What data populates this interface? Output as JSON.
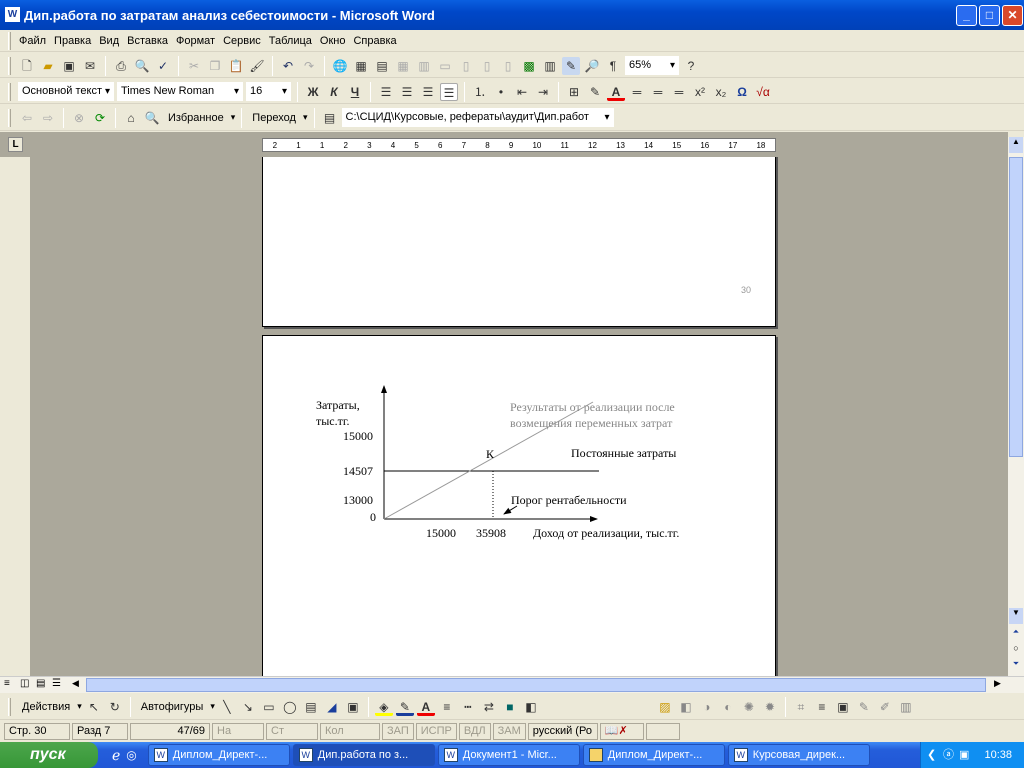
{
  "window": {
    "title": "Дип.работа по затратам анализ себестоимости - Microsoft Word"
  },
  "menu": [
    "Файл",
    "Правка",
    "Вид",
    "Вставка",
    "Формат",
    "Сервис",
    "Таблица",
    "Окно",
    "Справка"
  ],
  "standard_toolbar": {
    "zoom": "65%",
    "pilcrow": "¶"
  },
  "formatting_toolbar": {
    "style": "Основной текст",
    "font": "Times New Roman",
    "size": "16",
    "bold": "Ж",
    "italic": "К",
    "underline": "Ч",
    "superscript": "x²",
    "subscript": "x₂",
    "omega": "Ω",
    "formula": "√α"
  },
  "web_toolbar": {
    "favorites": "Избранное",
    "go": "Переход",
    "address": "C:\\СЦИД\\Курсовые, рефераты\\аудит\\Дип.работ"
  },
  "ruler": {
    "corner": "L",
    "labels": [
      "2",
      "1",
      "1",
      "2",
      "3",
      "4",
      "5",
      "6",
      "7",
      "8",
      "9",
      "10",
      "11",
      "12",
      "13",
      "14",
      "15",
      "16",
      "17",
      "18"
    ]
  },
  "document": {
    "page_number": "30",
    "chart": {
      "y_label_1": "Затраты,",
      "y_label_2": "тыс.тг.",
      "y_ticks": [
        "15000",
        "14507",
        "13000",
        "0"
      ],
      "x_ticks": [
        "15000",
        "35908"
      ],
      "x_label": "Доход от реализации, тыс.тг.",
      "point_label": "К",
      "line_label_1": "Результаты от реализации после",
      "line_label_2": "возмещения переменных затрат",
      "fixed_label": "Постоянные затраты",
      "threshold_label": "Порог рентабельности"
    }
  },
  "drawing_toolbar": {
    "actions": "Действия",
    "autoshapes": "Автофигуры"
  },
  "status": {
    "page": "Стр. 30",
    "section": "Разд 7",
    "pages": "47/69",
    "at": "На",
    "line": "Ст",
    "col": "Кол",
    "rec": "ЗАП",
    "trk": "ИСПР",
    "ext": "ВДЛ",
    "ovr": "ЗАМ",
    "lang": "русский (Ро"
  },
  "taskbar": {
    "start": "пуск",
    "tasks": [
      "Диплом_Директ-...",
      "Дип.работа по з...",
      "Документ1 - Micr...",
      "Диплом_Директ-...",
      "Курсовая_дирек..."
    ],
    "clock": "10:38"
  }
}
